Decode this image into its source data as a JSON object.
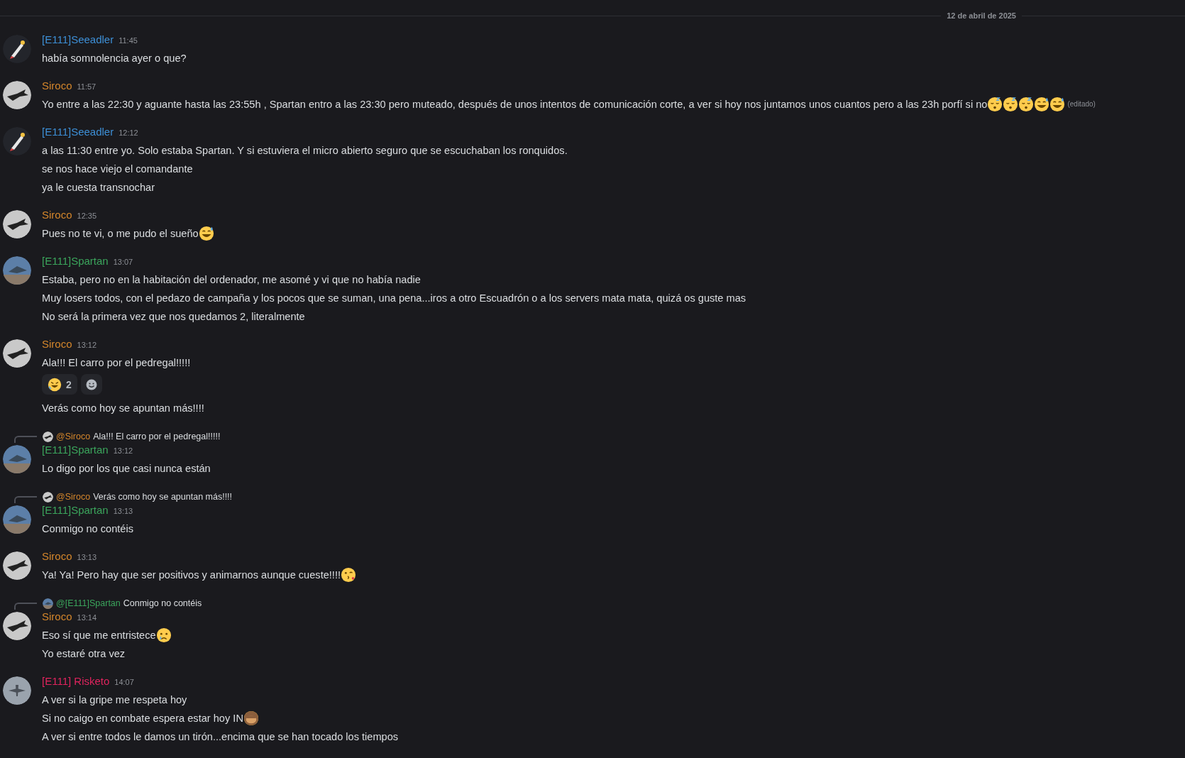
{
  "date_divider": "12 de abril de 2025",
  "messages": [
    {
      "author": "[E111]Seeadler",
      "color": "#3d8fd6",
      "avatar": {
        "kind": "rocket"
      },
      "time": "11:45",
      "lines": [
        {
          "text": "había somnolencia ayer o que?"
        }
      ]
    },
    {
      "author": "Siroco",
      "color": "#d4862b",
      "avatar": {
        "kind": "moon"
      },
      "time": "11:57",
      "lines": [
        {
          "text": "Yo entre a las 22:30 y aguante hasta las 23:55h , Spartan entro a las 23:30 pero muteado, después de unos intentos de comunicación corte, a ver si hoy nos juntamos unos cuantos pero a las 23h porfí si no",
          "emojis": [
            {
              "kind": "sleepy"
            },
            {
              "kind": "sleepy"
            },
            {
              "kind": "sleepy"
            },
            {
              "kind": "sweat"
            },
            {
              "kind": "sweat"
            }
          ],
          "edited": "(editado)"
        }
      ]
    },
    {
      "author": "[E111]Seeadler",
      "color": "#3d8fd6",
      "avatar": {
        "kind": "rocket"
      },
      "time": "12:12",
      "lines": [
        {
          "text": "a las 11:30 entre yo. Solo estaba Spartan. Y si estuviera el micro abierto seguro que se escuchaban los ronquidos."
        },
        {
          "text": "se nos hace viejo el comandante"
        },
        {
          "text": "ya le cuesta transnochar"
        }
      ]
    },
    {
      "author": "Siroco",
      "color": "#d4862b",
      "avatar": {
        "kind": "moon"
      },
      "time": "12:35",
      "lines": [
        {
          "text": "Pues no te vi, o me pudo el sueño",
          "emojis": [
            {
              "kind": "sweat"
            }
          ]
        }
      ]
    },
    {
      "author": "[E111]Spartan",
      "color": "#3ba55c",
      "avatar": {
        "kind": "sky"
      },
      "time": "13:07",
      "lines": [
        {
          "text": "Estaba, pero no en la habitación del ordenador, me asomé y vi que no había nadie"
        },
        {
          "text": "Muy losers todos, con el pedazo de campaña y los pocos que se suman, una pena...iros a otro Escuadrón o a los servers mata mata, quizá os guste mas"
        },
        {
          "text": "No será la primera vez que nos quedamos 2, literalmente"
        }
      ]
    },
    {
      "author": "Siroco",
      "color": "#d4862b",
      "avatar": {
        "kind": "moon"
      },
      "time": "13:12",
      "lines": [
        {
          "text": "Ala!!! El carro por el pedregal!!!!!",
          "reactions": [
            {
              "kind": "rofl",
              "count": "2"
            }
          ]
        },
        {
          "text": "Verás como hoy se apuntan más!!!!"
        }
      ]
    },
    {
      "author": "[E111]Spartan",
      "color": "#3ba55c",
      "avatar": {
        "kind": "sky"
      },
      "time": "13:12",
      "reply": {
        "author": "@Siroco",
        "color": "#d4862b",
        "avatar": {
          "kind": "moon"
        },
        "text": "Ala!!! El carro por el pedregal!!!!!"
      },
      "lines": [
        {
          "text": "Lo digo por los que casi nunca están"
        }
      ]
    },
    {
      "author": "[E111]Spartan",
      "color": "#3ba55c",
      "avatar": {
        "kind": "sky"
      },
      "time": "13:13",
      "reply": {
        "author": "@Siroco",
        "color": "#d4862b",
        "avatar": {
          "kind": "moon"
        },
        "text": "Verás como hoy se apuntan más!!!!"
      },
      "lines": [
        {
          "text": "Conmigo no contéis"
        }
      ]
    },
    {
      "author": "Siroco",
      "color": "#d4862b",
      "avatar": {
        "kind": "moon"
      },
      "time": "13:13",
      "lines": [
        {
          "text": "Ya! Ya! Pero hay que ser positivos y animarnos aunque cueste!!!!",
          "emojis": [
            {
              "kind": "kiss"
            }
          ]
        }
      ]
    },
    {
      "author": "Siroco",
      "color": "#d4862b",
      "avatar": {
        "kind": "moon"
      },
      "time": "13:14",
      "reply": {
        "author": "@[E111]Spartan",
        "color": "#3ba55c",
        "avatar": {
          "kind": "sky"
        },
        "text": "Conmigo no contéis"
      },
      "lines": [
        {
          "text": "Eso sí que me entristece",
          "emojis": [
            {
              "kind": "sad"
            }
          ]
        },
        {
          "text": "Yo estaré otra vez"
        }
      ]
    },
    {
      "author": "[E111] Risketo",
      "color": "#e0245e",
      "avatar": {
        "kind": "grey"
      },
      "time": "14:07",
      "lines": [
        {
          "text": "A ver si la gripe me respeta hoy"
        },
        {
          "text": "Si no caigo en combate espera estar hoy IN",
          "emojis": [
            {
              "kind": "monkey"
            }
          ]
        },
        {
          "text": "A ver si entre todos le damos un tirón...encima que se han tocado los tiempos"
        }
      ]
    }
  ]
}
